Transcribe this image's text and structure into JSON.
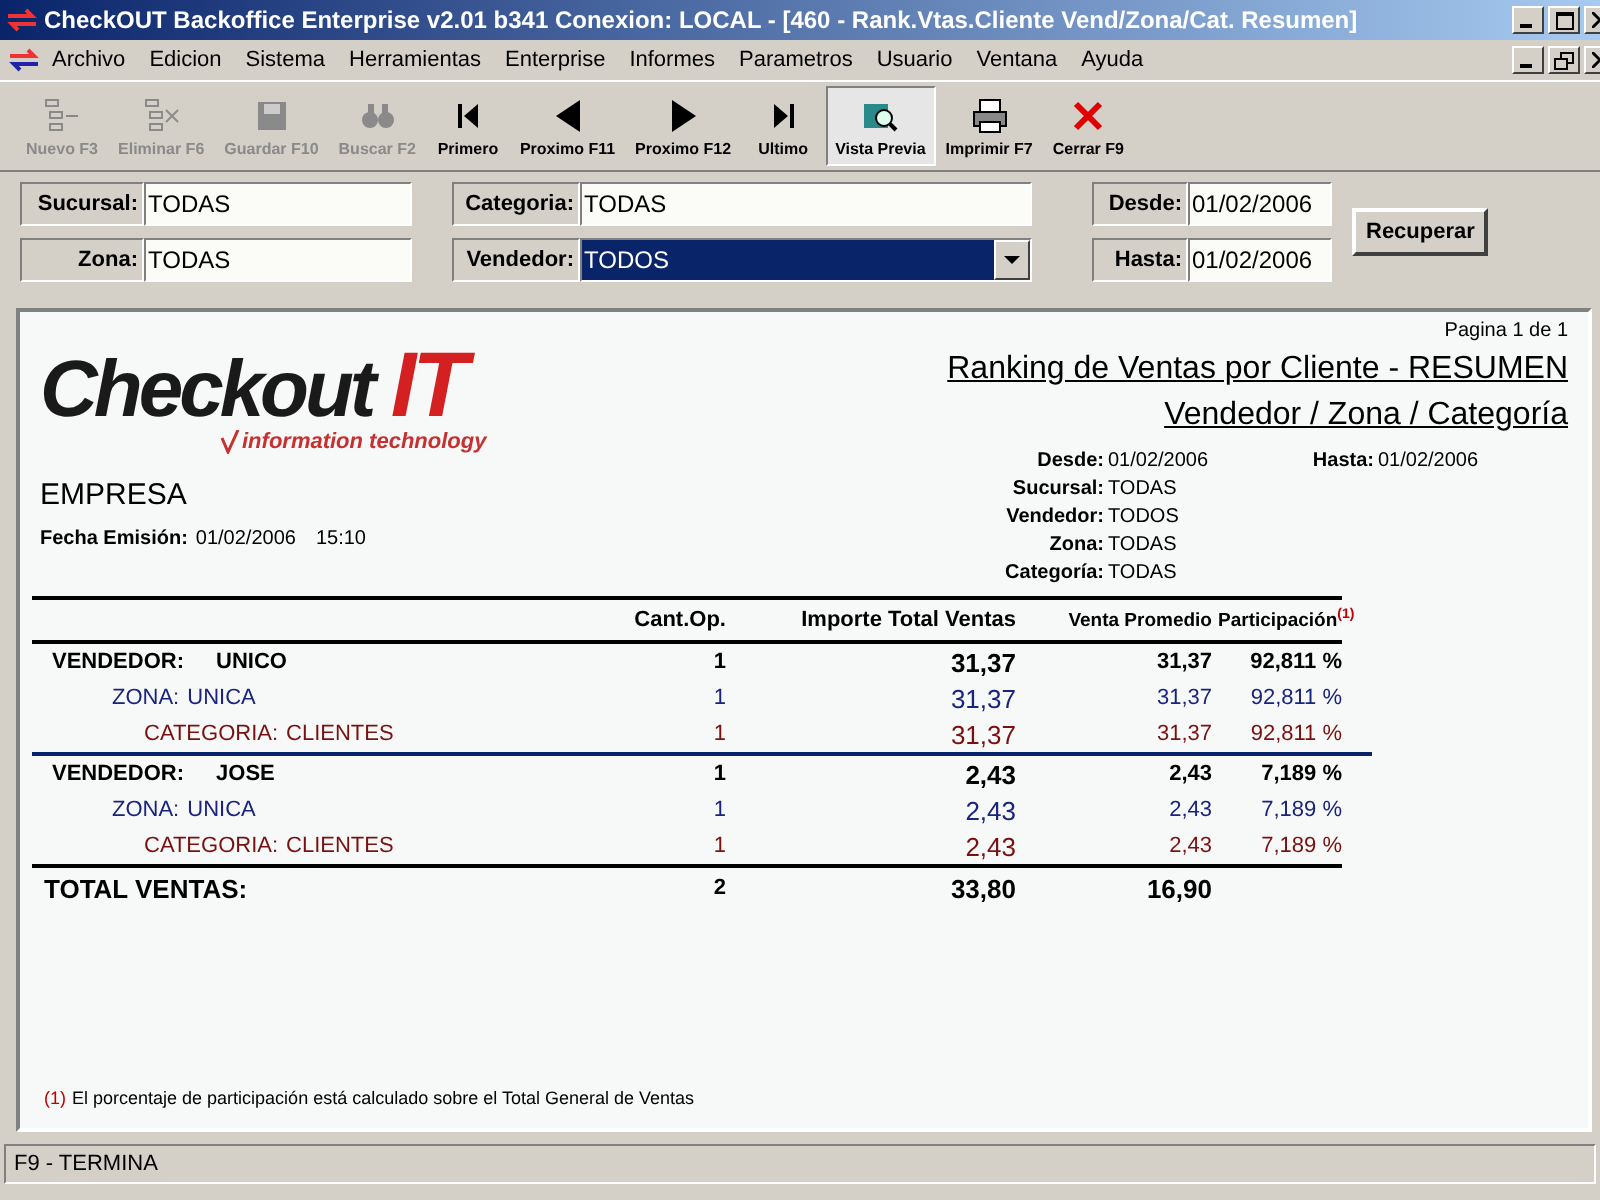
{
  "window": {
    "title": "CheckOUT Backoffice Enterprise v2.01 b341 Conexion: LOCAL - [460 - Rank.Vtas.Cliente Vend/Zona/Cat. Resumen]"
  },
  "menu": [
    "Archivo",
    "Edicion",
    "Sistema",
    "Herramientas",
    "Enterprise",
    "Informes",
    "Parametros",
    "Usuario",
    "Ventana",
    "Ayuda"
  ],
  "toolbar": [
    {
      "label": "Nuevo F3",
      "disabled": true,
      "pressed": false
    },
    {
      "label": "Eliminar F6",
      "disabled": true,
      "pressed": false
    },
    {
      "label": "Guardar F10",
      "disabled": true,
      "pressed": false
    },
    {
      "label": "Buscar F2",
      "disabled": true,
      "pressed": false
    },
    {
      "label": "Primero",
      "disabled": false,
      "pressed": false
    },
    {
      "label": "Proximo F11",
      "disabled": false,
      "pressed": false
    },
    {
      "label": "Proximo F12",
      "disabled": false,
      "pressed": false
    },
    {
      "label": "Ultimo",
      "disabled": false,
      "pressed": false
    },
    {
      "label": "Vista Previa",
      "disabled": false,
      "pressed": true
    },
    {
      "label": "Imprimir F7",
      "disabled": false,
      "pressed": false
    },
    {
      "label": "Cerrar F9",
      "disabled": false,
      "pressed": false
    }
  ],
  "filters": {
    "sucursal": {
      "label": "Sucursal:",
      "value": "TODAS"
    },
    "zona": {
      "label": "Zona:",
      "value": "TODAS"
    },
    "categoria": {
      "label": "Categoria:",
      "value": "TODAS"
    },
    "vendedor": {
      "label": "Vendedor:",
      "value": "TODOS",
      "selected": true
    },
    "desde": {
      "label": "Desde:",
      "value": "01/02/2006"
    },
    "hasta": {
      "label": "Hasta:",
      "value": "01/02/2006"
    },
    "button": "Recuperar"
  },
  "report": {
    "page": "Pagina 1 de 1",
    "logo": {
      "word": "Checkout",
      "accent": "IT",
      "tagline": "information technology"
    },
    "title": "Ranking de Ventas por Cliente - RESUMEN",
    "subtitle": "Vendedor / Zona / Categoría",
    "company": "EMPRESA",
    "issued": {
      "label": "Fecha Emisión:",
      "date": "01/02/2006",
      "time": "15:10"
    },
    "params": [
      {
        "label": "Desde:",
        "value": "01/02/2006",
        "extra_label": "Hasta:",
        "extra_value": "01/02/2006"
      },
      {
        "label": "Sucursal:",
        "value": "TODAS"
      },
      {
        "label": "Vendedor:",
        "value": "TODOS"
      },
      {
        "label": "Zona:",
        "value": "TODAS"
      },
      {
        "label": "Categoría:",
        "value": "TODAS"
      }
    ],
    "columns": [
      "Cant.Op.",
      "Importe Total Ventas",
      "Venta Promedio",
      "Participación$^{(1)}$"
    ],
    "rows": [
      {
        "kind": "vendedor",
        "label": "VENDEDOR:",
        "name": "UNICO",
        "cant": "1",
        "importe": "31,37",
        "promedio": "31,37",
        "part": "92,811 %"
      },
      {
        "kind": "zona",
        "label": "ZONA:",
        "name": "UNICA",
        "cant": "1",
        "importe": "31,37",
        "promedio": "31,37",
        "part": "92,811 %"
      },
      {
        "kind": "categoria",
        "label": "CATEGORIA:",
        "name": "CLIENTES",
        "cant": "1",
        "importe": "31,37",
        "promedio": "31,37",
        "part": "92,811 %"
      },
      {
        "kind": "vendedor",
        "label": "VENDEDOR:",
        "name": "JOSE",
        "cant": "1",
        "importe": "2,43",
        "promedio": "2,43",
        "part": "7,189 %"
      },
      {
        "kind": "zona",
        "label": "ZONA:",
        "name": "UNICA",
        "cant": "1",
        "importe": "2,43",
        "promedio": "2,43",
        "part": "7,189 %"
      },
      {
        "kind": "categoria",
        "label": "CATEGORIA:",
        "name": "CLIENTES",
        "cant": "1",
        "importe": "2,43",
        "promedio": "2,43",
        "part": "7,189 %"
      }
    ],
    "total": {
      "label": "TOTAL VENTAS:",
      "cant": "2",
      "importe": "33,80",
      "promedio": "16,90"
    },
    "footnote": {
      "marker": "(1)",
      "text": "El porcentaje de participación está calculado sobre el Total General de Ventas"
    }
  },
  "status_bar": "F9 - TERMINA"
}
